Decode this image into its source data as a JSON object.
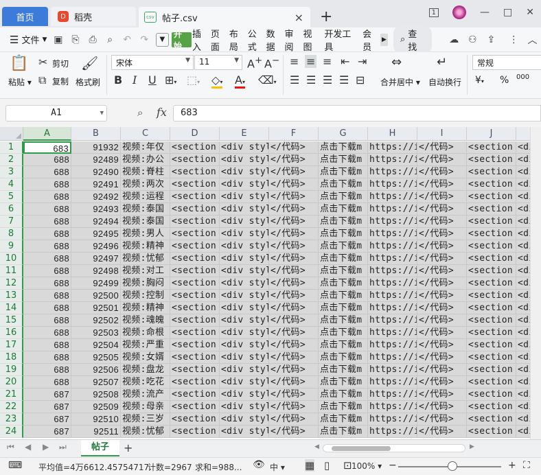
{
  "titlebar": {
    "home_tab": "首页",
    "app_tab": "稻壳",
    "file_tab": "帖子.csv",
    "file_badge": "csv",
    "app_badge": "D",
    "close": "×",
    "new_tab": "+",
    "win_badge": "1",
    "minimize": "—",
    "maximize": "□",
    "close_win": "✕"
  },
  "menubar": {
    "file_label": "文件",
    "tabs": [
      "开始",
      "插入",
      "页面",
      "布局",
      "公式",
      "数据",
      "审阅",
      "视图",
      "开发工具",
      "会员"
    ],
    "search": "查找"
  },
  "ribbon": {
    "paste": "粘贴",
    "cut": "剪切",
    "copy": "复制",
    "format_painter": "格式刷",
    "font_name": "宋体",
    "font_size": "11",
    "bold": "B",
    "italic": "I",
    "underline": "U",
    "merge": "合并居中",
    "wrap": "自动换行",
    "number_format": "常规",
    "currency": "¥",
    "percent": "%",
    "thousands": "000"
  },
  "formula": {
    "name_box": "A1",
    "fx": "fx",
    "value": "683"
  },
  "columns": [
    "A",
    "B",
    "C",
    "D",
    "E",
    "F",
    "G",
    "H",
    "I",
    "J"
  ],
  "rows": [
    {
      "n": "1",
      "a": "683",
      "b": "91932",
      "c": "视频:年仅"
    },
    {
      "n": "2",
      "a": "688",
      "b": "92489",
      "c": "视频:办公"
    },
    {
      "n": "3",
      "a": "688",
      "b": "92490",
      "c": "视频:脊柱"
    },
    {
      "n": "4",
      "a": "688",
      "b": "92491",
      "c": "视频:两次"
    },
    {
      "n": "5",
      "a": "688",
      "b": "92492",
      "c": "视频:运程"
    },
    {
      "n": "6",
      "a": "688",
      "b": "92493",
      "c": "视频:泰国"
    },
    {
      "n": "7",
      "a": "688",
      "b": "92494",
      "c": "视频:泰国"
    },
    {
      "n": "8",
      "a": "688",
      "b": "92495",
      "c": "视频:男人"
    },
    {
      "n": "9",
      "a": "688",
      "b": "92496",
      "c": "视频:精神"
    },
    {
      "n": "10",
      "a": "688",
      "b": "92497",
      "c": "视频:忧郁"
    },
    {
      "n": "11",
      "a": "688",
      "b": "92498",
      "c": "视频:对工"
    },
    {
      "n": "12",
      "a": "688",
      "b": "92499",
      "c": "视频:胸闷"
    },
    {
      "n": "13",
      "a": "688",
      "b": "92500",
      "c": "视频:控制"
    },
    {
      "n": "14",
      "a": "688",
      "b": "92501",
      "c": "视频:精神"
    },
    {
      "n": "15",
      "a": "688",
      "b": "92502",
      "c": "视频:魂魄"
    },
    {
      "n": "16",
      "a": "688",
      "b": "92503",
      "c": "视频:命根"
    },
    {
      "n": "17",
      "a": "688",
      "b": "92504",
      "c": "视频:严重"
    },
    {
      "n": "18",
      "a": "688",
      "b": "92505",
      "c": "视频:女婿"
    },
    {
      "n": "19",
      "a": "688",
      "b": "92506",
      "c": "视频:盘龙"
    },
    {
      "n": "20",
      "a": "688",
      "b": "92507",
      "c": "视频:吃花"
    },
    {
      "n": "21",
      "a": "687",
      "b": "92508",
      "c": "视频:流产"
    },
    {
      "n": "22",
      "a": "687",
      "b": "92509",
      "c": "视频:母亲"
    },
    {
      "n": "23",
      "a": "687",
      "b": "92510",
      "c": "视频:三岁"
    },
    {
      "n": "24",
      "a": "687",
      "b": "92511",
      "c": "视频:忧郁"
    }
  ],
  "repeat_cells": {
    "d": "<section",
    "e": "<div styl",
    "f": "</代码>",
    "g": "点击下载m",
    "h": "https://i",
    "i": "</代码>",
    "j": "<section",
    "k": "<di"
  },
  "sheet": {
    "tab": "帖子",
    "add": "+"
  },
  "status": {
    "average": "平均值=4万6612.45754717",
    "count": "计数=2967",
    "sum": "求和=988...",
    "zoom": "100%",
    "zoom_out": "−",
    "zoom_in": "+"
  }
}
